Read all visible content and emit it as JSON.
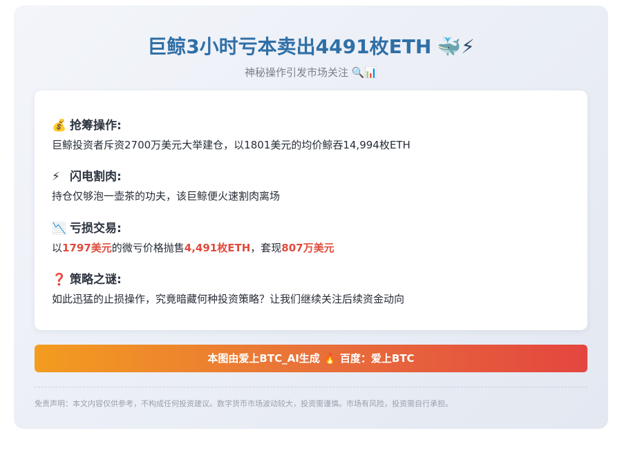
{
  "header": {
    "title": "巨鲸3小时亏本卖出4491枚ETH",
    "title_emoji": "🐳⚡",
    "subtitle": "神秘操作引发市场关注 🔍📊"
  },
  "sections": [
    {
      "icon": "money-bag-icon",
      "icon_glyph": "💰",
      "title": "抢筹操作:",
      "text": "巨鲸投资者斥资2700万美元大举建仓，以1801美元的均价鲸吞14,994枚ETH"
    },
    {
      "icon": "lightning-icon",
      "icon_glyph": "⚡",
      "title": "闪电割肉:",
      "text": "持仓仅够泡一壶茶的功夫，该巨鲸便火速割肉离场"
    },
    {
      "icon": "chart-down-icon",
      "icon_glyph": "📉",
      "title": "亏损交易:",
      "text_parts": [
        "以",
        "1797美元",
        "的微亏价格抛售",
        "4,491枚ETH",
        "，套现",
        "807万美元"
      ]
    },
    {
      "icon": "question-icon",
      "icon_glyph": "❓",
      "title": "策略之谜:",
      "text": "如此迅猛的止损操作，究竟暗藏何种投资策略？让我们继续关注后续资金动向"
    }
  ],
  "banner": {
    "text": "本图由爱上BTC_AI生成 🔥 百度：爱上BTC"
  },
  "disclaimer": "免责声明：本文内容仅供参考，不构成任何投资建议。数字货币市场波动较大，投资需谨慎。市场有风险，投资需自行承担。",
  "colors": {
    "title": "#2f6fa6",
    "highlight": "#e04b3c",
    "banner_start": "#f39c1f",
    "banner_end": "#e4463f"
  }
}
